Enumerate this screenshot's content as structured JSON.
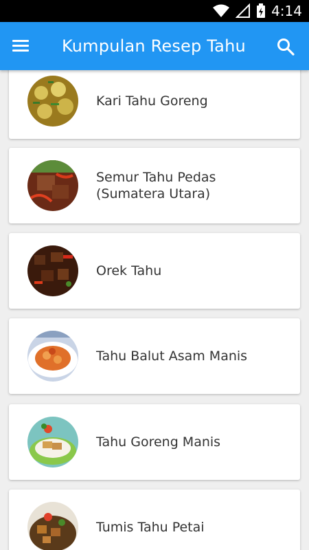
{
  "status_bar": {
    "time": "4:14"
  },
  "app_bar": {
    "title": "Kumpulan Resep Tahu",
    "menu_icon": "hamburger-menu-icon",
    "search_icon": "search-icon"
  },
  "recipes": [
    {
      "title": "Kari Tahu Goreng"
    },
    {
      "title": "Semur Tahu Pedas (Sumatera Utara)"
    },
    {
      "title": "Orek Tahu"
    },
    {
      "title": "Tahu Balut Asam Manis"
    },
    {
      "title": "Tahu Goreng Manis"
    },
    {
      "title": "Tumis Tahu Petai"
    }
  ],
  "colors": {
    "app_bar": "#2196f3",
    "status_bar": "#000000",
    "background": "#efefef",
    "card": "#ffffff"
  }
}
